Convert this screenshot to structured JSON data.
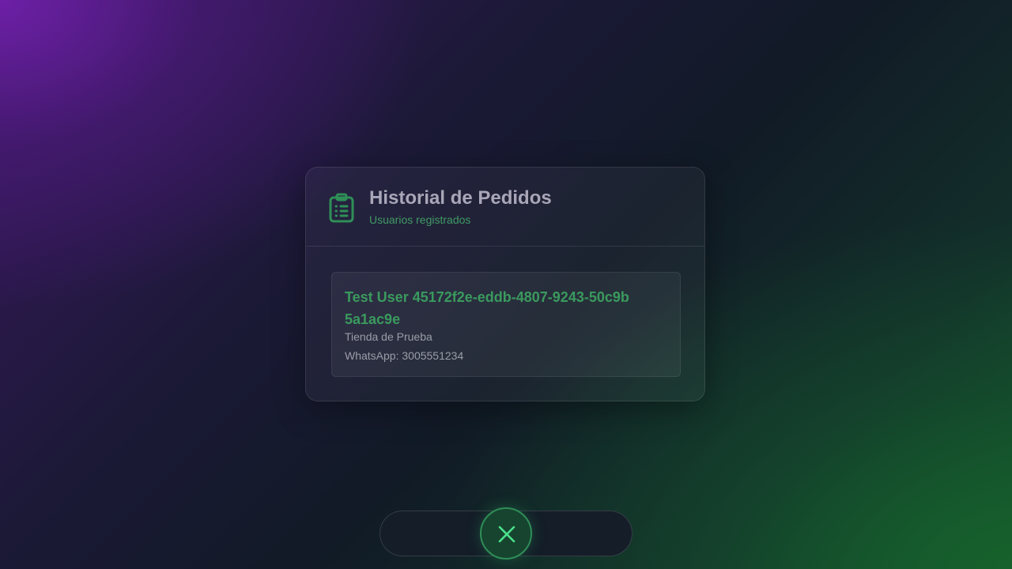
{
  "panel": {
    "icon": "clipboard-list-icon",
    "title": "Historial de Pedidos",
    "subtitle": "Usuarios registrados"
  },
  "users": [
    {
      "name": "Test User 45172f2e-eddb-4807-9243-50c9b5a1ac9e",
      "store": "Tienda de Prueba",
      "whatsapp": "WhatsApp: 3005551234"
    }
  ],
  "bottom_bar": {
    "close_icon": "close-icon"
  },
  "colors": {
    "accent_green": "#3a9a5e",
    "title_gray": "#a9a6b8",
    "text_gray": "#9a9ea6"
  }
}
